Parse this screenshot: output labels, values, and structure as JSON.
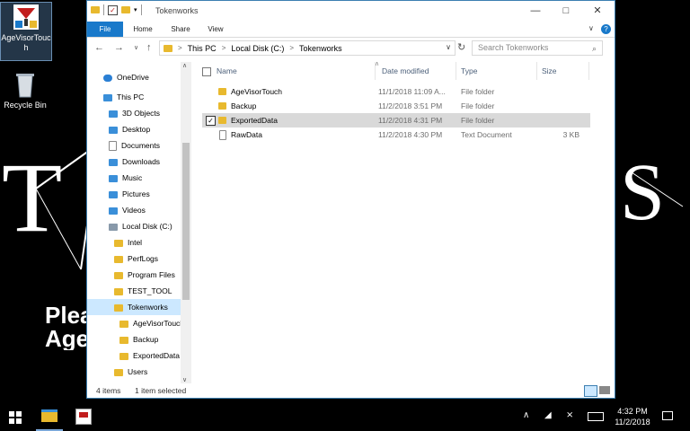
{
  "desktop": {
    "icons": [
      {
        "label": "AgeVisorTouch",
        "icon": "agevisor-app-icon"
      },
      {
        "label": "Recycle Bin",
        "icon": "recycle-bin-icon"
      }
    ],
    "wallpaper_text": [
      "Plea",
      "Age"
    ]
  },
  "window": {
    "title": "Tokenworks",
    "ribbon_tabs": [
      "File",
      "Home",
      "Share",
      "View"
    ],
    "address": [
      "This PC",
      "Local Disk (C:)",
      "Tokenworks"
    ],
    "search_placeholder": "Search Tokenworks",
    "nav_items": [
      {
        "label": "OneDrive",
        "icon": "onedrive-icon"
      },
      {
        "label": "This PC",
        "icon": "pc-icon"
      },
      {
        "label": "3D Objects",
        "icon": "folder-icon"
      },
      {
        "label": "Desktop",
        "icon": "folder-icon"
      },
      {
        "label": "Documents",
        "icon": "folder-icon"
      },
      {
        "label": "Downloads",
        "icon": "folder-icon"
      },
      {
        "label": "Music",
        "icon": "folder-icon"
      },
      {
        "label": "Pictures",
        "icon": "folder-icon"
      },
      {
        "label": "Videos",
        "icon": "folder-icon"
      },
      {
        "label": "Local Disk (C:)",
        "icon": "drive-icon"
      },
      {
        "label": "Intel",
        "icon": "folder-icon"
      },
      {
        "label": "PerfLogs",
        "icon": "folder-icon"
      },
      {
        "label": "Program Files",
        "icon": "folder-icon"
      },
      {
        "label": "TEST_TOOL",
        "icon": "folder-icon"
      },
      {
        "label": "Tokenworks",
        "icon": "folder-icon",
        "selected": true
      },
      {
        "label": "AgeVisorTouch",
        "icon": "folder-icon"
      },
      {
        "label": "Backup",
        "icon": "folder-icon"
      },
      {
        "label": "ExportedData",
        "icon": "folder-icon"
      },
      {
        "label": "Users",
        "icon": "folder-icon"
      }
    ],
    "columns": [
      "Name",
      "Date modified",
      "Type",
      "Size"
    ],
    "files": [
      {
        "name": "AgeVisorTouch",
        "date": "11/1/2018 11:09 A...",
        "type": "File folder",
        "size": "",
        "icon": "folder-icon",
        "selected": false
      },
      {
        "name": "Backup",
        "date": "11/2/2018 3:51 PM",
        "type": "File folder",
        "size": "",
        "icon": "folder-icon",
        "selected": false
      },
      {
        "name": "ExportedData",
        "date": "11/2/2018 4:31 PM",
        "type": "File folder",
        "size": "",
        "icon": "folder-icon",
        "selected": true
      },
      {
        "name": "RawData",
        "date": "11/2/2018 4:30 PM",
        "type": "Text Document",
        "size": "3 KB",
        "icon": "text-document-icon",
        "selected": false
      }
    ],
    "status": {
      "count": "4 items",
      "selection": "1 item selected"
    }
  },
  "taskbar": {
    "time": "4:32 PM",
    "date": "11/2/2018"
  },
  "colors": {
    "accent": "#1979ca",
    "selection": "#cce8ff",
    "folder": "#e8b92e"
  }
}
